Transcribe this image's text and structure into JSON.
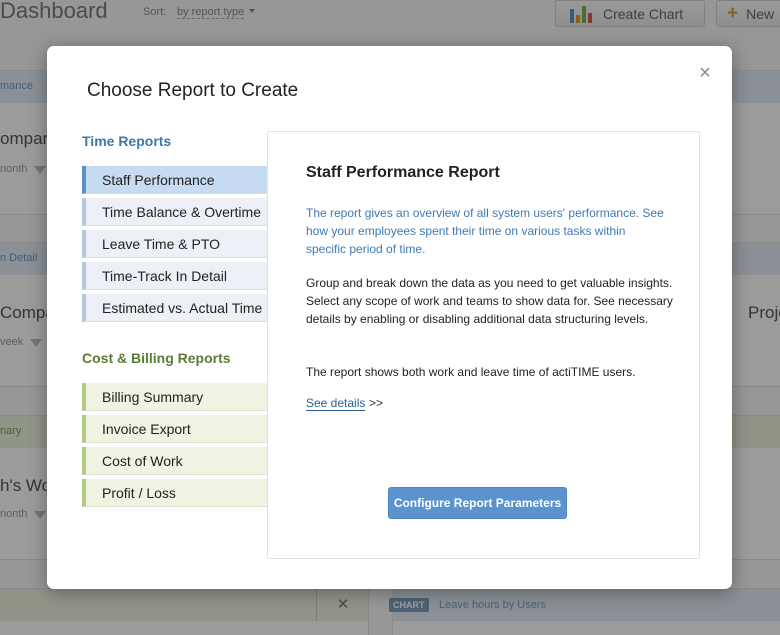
{
  "background": {
    "title": "Dashboard",
    "sort_label": "Sort:",
    "sort_value": "by report type",
    "create_chart_label": "Create Chart",
    "new_label": "New",
    "cards": [
      {
        "header": "mance",
        "name": "ompar",
        "period": "nonth"
      },
      {
        "header": "n Detail",
        "name": "Compa",
        "period": "veek"
      },
      {
        "header": "nary",
        "name": "h's Wo",
        "period": "nonth"
      }
    ],
    "right_card_name": "Projects",
    "chart_badge": "CHART",
    "chart_card_title": "Leave hours by Users",
    "close_glyph": "✕"
  },
  "modal": {
    "title": "Choose Report to Create",
    "close_glyph": "×",
    "time_group": {
      "title": "Time Reports",
      "items": [
        "Staff Performance",
        "Time Balance & Overtime",
        "Leave Time & PTO",
        "Time-Track In Detail",
        "Estimated vs. Actual Time"
      ]
    },
    "cost_group": {
      "title": "Cost & Billing Reports",
      "items": [
        "Billing Summary",
        "Invoice Export",
        "Cost of Work",
        "Profit / Loss"
      ]
    },
    "detail": {
      "title": "Staff Performance Report",
      "lead": "The report gives an overview of all system users' performance. See how your employees spent their time on various tasks within specific period of time.",
      "p1": "Group and break down the data as you need to get valuable insights. Select any scope of work and teams to show data for. See necessary details by enabling or disabling additional data structuring levels.",
      "p2": "The report shows both work and leave time of actiTIME users.",
      "see_details": "See details",
      "see_arrows": ">>",
      "configure_label": "Configure Report Parameters"
    }
  },
  "colors": {
    "time_group": "#3d78a8",
    "cost_group": "#5a7d38",
    "selected_item": "#c6daf1",
    "primary_button": "#5b93cf"
  }
}
